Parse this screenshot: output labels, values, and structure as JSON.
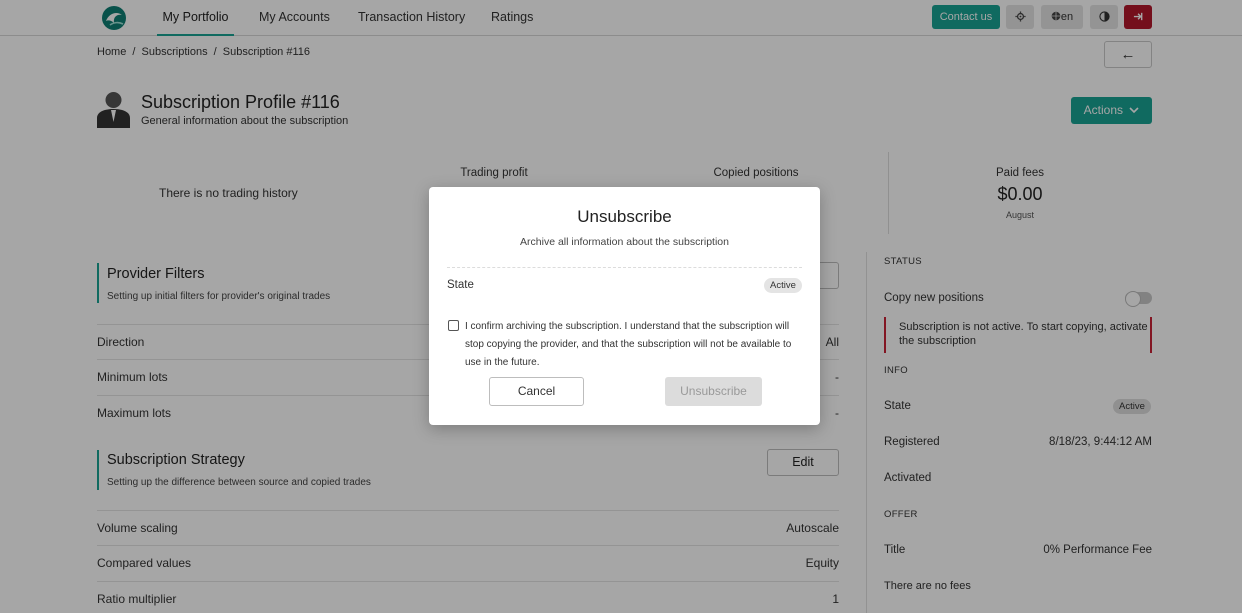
{
  "nav": {
    "items": [
      {
        "label": "My Portfolio"
      },
      {
        "label": "My Accounts"
      },
      {
        "label": "Transaction History"
      },
      {
        "label": "Ratings"
      }
    ],
    "contact_label": "Contact us",
    "lang_label": "en",
    "accent_color": "#1aa394",
    "logout_color": "#b3172c"
  },
  "breadcrumb": {
    "home": "Home",
    "sep1": "/",
    "subscriptions": "Subscriptions",
    "sep2": "/",
    "current": "Subscription #116"
  },
  "back_icon": "←",
  "header": {
    "title": "Subscription Profile #116",
    "subtitle": "General information about the subscription",
    "actions_label": "Actions"
  },
  "stats": {
    "no_history": "There is no trading history",
    "trading_profit_label": "Trading profit",
    "copied_positions_label": "Copied positions",
    "paid_fees_label": "Paid fees",
    "paid_fees_value": "$0.00",
    "paid_fees_period": "August"
  },
  "provider_filters": {
    "title": "Provider Filters",
    "subtitle": "Setting up initial filters for provider's original trades",
    "rows": [
      {
        "k": "Direction",
        "v": "All"
      },
      {
        "k": "Minimum lots",
        "v": "-"
      },
      {
        "k": "Maximum lots",
        "v": "-"
      }
    ]
  },
  "strategy": {
    "title": "Subscription Strategy",
    "subtitle": "Setting up the difference between source and copied trades",
    "edit_label": "Edit",
    "rows": [
      {
        "k": "Volume scaling",
        "v": "Autoscale"
      },
      {
        "k": "Compared values",
        "v": "Equity"
      },
      {
        "k": "Ratio multiplier",
        "v": "1"
      }
    ]
  },
  "sidebar": {
    "status_head": "STATUS",
    "copy_new_positions": "Copy new positions",
    "warning": "Subscription is not active. To start copying, activate the subscription",
    "info_head": "INFO",
    "state_k": "State",
    "state_v": "Active",
    "registered_k": "Registered",
    "registered_v": "8/18/23, 9:44:12 AM",
    "activated_k": "Activated",
    "offer_head": "OFFER",
    "title_k": "Title",
    "title_v": "0% Performance Fee",
    "no_fees": "There are no fees"
  },
  "modal": {
    "title": "Unsubscribe",
    "subtitle": "Archive all information about the subscription",
    "state_k": "State",
    "state_v": "Active",
    "confirm_text": "I confirm archiving the subscription. I understand that the subscription will stop copying the provider, and that the subscription will not be available to use in the future.",
    "cancel_label": "Cancel",
    "unsubscribe_label": "Unsubscribe"
  }
}
